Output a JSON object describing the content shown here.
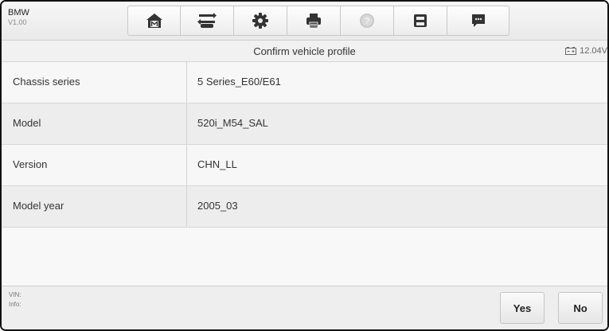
{
  "app": {
    "name": "BMW",
    "version": "V1.00"
  },
  "toolbar": {
    "buttons": [
      {
        "icon": "home-icon"
      },
      {
        "icon": "vehicle-swap-icon"
      },
      {
        "icon": "gear-icon"
      },
      {
        "icon": "printer-icon"
      },
      {
        "icon": "help-icon"
      },
      {
        "icon": "save-icon"
      },
      {
        "icon": "message-icon"
      }
    ]
  },
  "header": {
    "title": "Confirm vehicle profile",
    "voltage": "12.04V"
  },
  "profile": {
    "rows": [
      {
        "label": "Chassis series",
        "value": "5 Series_E60/E61"
      },
      {
        "label": "Model",
        "value": "520i_M54_SAL"
      },
      {
        "label": "Version",
        "value": "CHN_LL"
      },
      {
        "label": "Model year",
        "value": "2005_03"
      }
    ]
  },
  "footer": {
    "vin_label": "VIN:",
    "info_label": "Info:",
    "yes_label": "Yes",
    "no_label": "No"
  }
}
